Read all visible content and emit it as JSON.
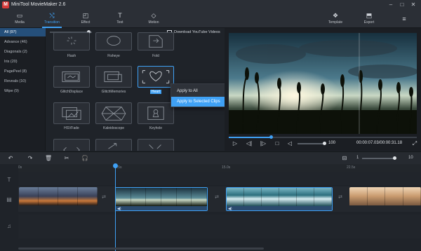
{
  "app": {
    "title": "MiniTool MovieMaker 2.6"
  },
  "toolbar": {
    "items": [
      {
        "label": "Media",
        "icon": "folder-icon"
      },
      {
        "label": "Transition",
        "icon": "transition-icon"
      },
      {
        "label": "Effect",
        "icon": "effect-icon"
      },
      {
        "label": "Text",
        "icon": "text-icon"
      },
      {
        "label": "Motion",
        "icon": "motion-icon"
      }
    ],
    "template": "Template",
    "export": "Export"
  },
  "categories": [
    {
      "label": "All (97)"
    },
    {
      "label": "Advance (46)"
    },
    {
      "label": "Diagonals (2)"
    },
    {
      "label": "Iris (20)"
    },
    {
      "label": "PagePeel (8)"
    },
    {
      "label": "Reveals (10)"
    },
    {
      "label": "Wipe (9)"
    }
  ],
  "gallery": {
    "download": "Download YouTube Videos",
    "row1": [
      "Flash",
      "Fisheye",
      "Fold"
    ],
    "row2": [
      "GlitchDisplace",
      "GlitchMemories",
      "Heart"
    ],
    "row3": [
      "HSVFade",
      "Kaleidoscope",
      "Keyhole"
    ]
  },
  "context_menu": {
    "apply_all": "Apply to All",
    "apply_selected": "Apply to Selected Clips"
  },
  "player": {
    "volume": "100",
    "timecode": "00:00:07.03/00:00:31.18"
  },
  "timeline": {
    "zoom_min": "1",
    "zoom_max": "10",
    "ruler": [
      "0s",
      "7.5s",
      "15.0s",
      "22.5s"
    ]
  },
  "colors": {
    "accent": "#3fa1f5",
    "bg": "#1f2329",
    "panel": "#2b2f36"
  }
}
